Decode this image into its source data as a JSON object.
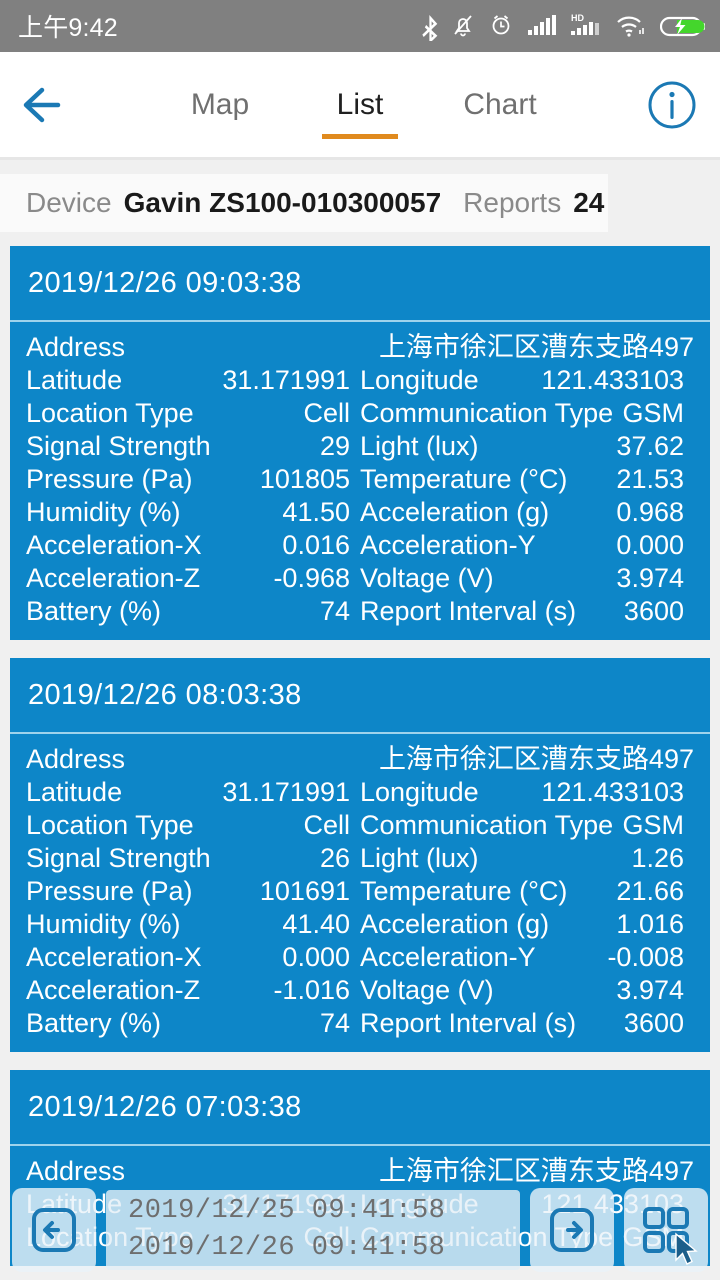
{
  "statusbar": {
    "clock": "上午9:42",
    "icons": [
      "bluetooth-icon",
      "bell-muted-icon",
      "alarm-clock-icon",
      "signal-bars-icon",
      "hd-signal-icon",
      "wifi-icon",
      "battery-charging-icon"
    ],
    "background": "#808080",
    "battery_color": "#44d62c"
  },
  "navbar": {
    "back_icon": "back-arrow-icon",
    "info_icon": "info-circle-icon",
    "accent": "#e08a1e",
    "icon_color": "#1b79b4",
    "tabs": [
      {
        "label": "Map",
        "active": false
      },
      {
        "label": "List",
        "active": true
      },
      {
        "label": "Chart",
        "active": false
      }
    ]
  },
  "summary": {
    "device_label": "Device",
    "device_value": "Gavin ZS100-010300057",
    "reports_label": "Reports",
    "reports_value": "24"
  },
  "card_color": "#0d86c8",
  "reports": [
    {
      "time": "2019/12/26 09:03:38",
      "address_label": "Address",
      "address_value": "上海市徐汇区漕东支路497",
      "rows": [
        {
          "k1": "Latitude",
          "v1": "31.171991",
          "k2": "Longitude",
          "v2": "121.433103"
        },
        {
          "k1": "Location Type",
          "v1": "Cell",
          "k2": "Communication Type",
          "v2": "GSM"
        },
        {
          "k1": "Signal Strength",
          "v1": "29",
          "k2": "Light (lux)",
          "v2": "37.62"
        },
        {
          "k1": "Pressure (Pa)",
          "v1": "101805",
          "k2": "Temperature (°C)",
          "v2": "21.53"
        },
        {
          "k1": "Humidity (%)",
          "v1": "41.50",
          "k2": "Acceleration (g)",
          "v2": "0.968"
        },
        {
          "k1": "Acceleration-X",
          "v1": "0.016",
          "k2": "Acceleration-Y",
          "v2": "0.000"
        },
        {
          "k1": "Acceleration-Z",
          "v1": "-0.968",
          "k2": "Voltage (V)",
          "v2": "3.974"
        },
        {
          "k1": "Battery (%)",
          "v1": "74",
          "k2": "Report Interval (s)",
          "v2": "3600"
        }
      ]
    },
    {
      "time": "2019/12/26 08:03:38",
      "address_label": "Address",
      "address_value": "上海市徐汇区漕东支路497",
      "rows": [
        {
          "k1": "Latitude",
          "v1": "31.171991",
          "k2": "Longitude",
          "v2": "121.433103"
        },
        {
          "k1": "Location Type",
          "v1": "Cell",
          "k2": "Communication Type",
          "v2": "GSM"
        },
        {
          "k1": "Signal Strength",
          "v1": "26",
          "k2": "Light (lux)",
          "v2": "1.26"
        },
        {
          "k1": "Pressure (Pa)",
          "v1": "101691",
          "k2": "Temperature (°C)",
          "v2": "21.66"
        },
        {
          "k1": "Humidity (%)",
          "v1": "41.40",
          "k2": "Acceleration (g)",
          "v2": "1.016"
        },
        {
          "k1": "Acceleration-X",
          "v1": "0.000",
          "k2": "Acceleration-Y",
          "v2": "-0.008"
        },
        {
          "k1": "Acceleration-Z",
          "v1": "-1.016",
          "k2": "Voltage (V)",
          "v2": "3.974"
        },
        {
          "k1": "Battery (%)",
          "v1": "74",
          "k2": "Report Interval (s)",
          "v2": "3600"
        }
      ]
    },
    {
      "time": "2019/12/26 07:03:38",
      "address_label": "Address",
      "address_value": "上海市徐汇区漕东支路497",
      "rows": [
        {
          "k1": "Latitude",
          "v1": "31.171991",
          "k2": "Longitude",
          "v2": "121.433103"
        },
        {
          "k1": "Location Type",
          "v1": "Cell",
          "k2": "Communication Type",
          "v2": "GSM"
        }
      ]
    }
  ],
  "overlay": {
    "prev_icon": "arrow-left-boxed-icon",
    "next_icon": "arrow-right-boxed-icon",
    "apps_icon": "grid-apps-icon",
    "range_from": "2019/12/25  09:41:58",
    "range_to": "2019/12/26  09:41:58"
  }
}
